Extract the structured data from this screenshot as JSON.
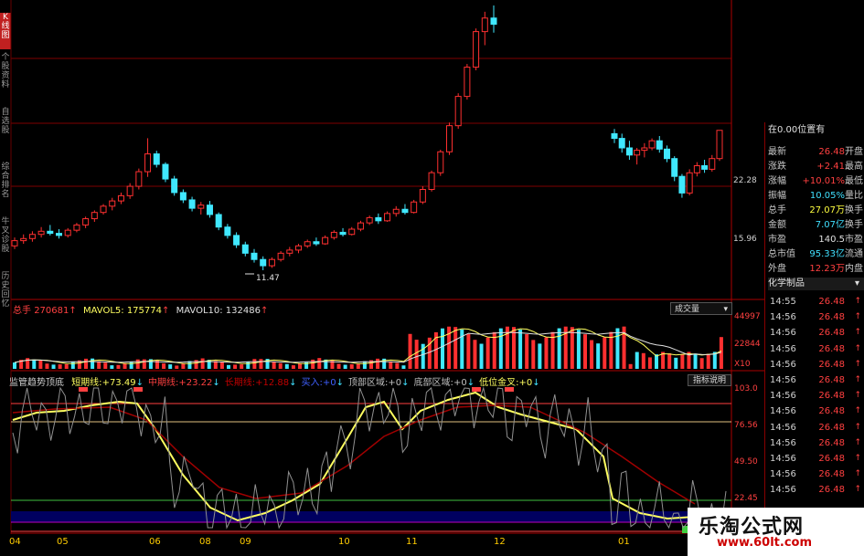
{
  "left_tabs": [
    {
      "label": "K线图",
      "active": true
    },
    {
      "label": "个股资料",
      "active": false
    },
    {
      "label": "自选股",
      "active": false
    },
    {
      "label": "综合排名",
      "active": false
    },
    {
      "label": "牛叉诊股",
      "active": false
    },
    {
      "label": "历史回忆",
      "active": false
    }
  ],
  "price_chart": {
    "price_labels": [
      "22.28",
      "15.96"
    ],
    "low_label": "11.47",
    "candles": [
      [
        13.8,
        14.6,
        13.5,
        14.3
      ],
      [
        14.3,
        14.9,
        14.0,
        14.5
      ],
      [
        14.5,
        15.2,
        14.2,
        14.9
      ],
      [
        14.9,
        15.6,
        14.6,
        15.2
      ],
      [
        15.2,
        15.8,
        14.8,
        15.0
      ],
      [
        15.0,
        15.4,
        14.5,
        14.8
      ],
      [
        14.8,
        15.5,
        14.6,
        15.3
      ],
      [
        15.3,
        16.0,
        15.1,
        15.8
      ],
      [
        15.8,
        16.6,
        15.5,
        16.4
      ],
      [
        16.4,
        17.2,
        16.1,
        17.0
      ],
      [
        17.0,
        17.8,
        16.8,
        17.6
      ],
      [
        17.6,
        18.4,
        17.2,
        18.1
      ],
      [
        18.1,
        18.9,
        17.8,
        18.6
      ],
      [
        18.6,
        19.8,
        18.3,
        19.5
      ],
      [
        19.5,
        21.2,
        19.2,
        20.9
      ],
      [
        20.9,
        24.1,
        20.4,
        22.6
      ],
      [
        22.6,
        22.9,
        21.3,
        21.6
      ],
      [
        21.6,
        21.8,
        19.9,
        20.2
      ],
      [
        20.2,
        20.5,
        18.6,
        18.9
      ],
      [
        18.9,
        19.2,
        17.9,
        18.2
      ],
      [
        18.2,
        18.5,
        17.1,
        17.4
      ],
      [
        17.4,
        18.0,
        16.8,
        17.7
      ],
      [
        17.7,
        18.1,
        16.5,
        16.8
      ],
      [
        16.8,
        17.0,
        15.3,
        15.6
      ],
      [
        15.6,
        15.9,
        14.5,
        14.8
      ],
      [
        14.8,
        15.1,
        13.6,
        13.9
      ],
      [
        13.9,
        14.2,
        12.8,
        13.1
      ],
      [
        13.1,
        13.5,
        12.2,
        12.5
      ],
      [
        12.5,
        12.8,
        11.47,
        11.9
      ],
      [
        11.9,
        12.7,
        11.7,
        12.5
      ],
      [
        12.5,
        13.3,
        12.3,
        13.1
      ],
      [
        13.1,
        13.7,
        12.8,
        13.4
      ],
      [
        13.4,
        14.0,
        13.1,
        13.8
      ],
      [
        13.8,
        14.4,
        13.6,
        14.2
      ],
      [
        14.2,
        14.6,
        13.8,
        14.0
      ],
      [
        14.0,
        14.8,
        13.9,
        14.6
      ],
      [
        14.6,
        15.3,
        14.4,
        15.1
      ],
      [
        15.1,
        15.5,
        14.7,
        14.9
      ],
      [
        14.9,
        15.6,
        14.8,
        15.4
      ],
      [
        15.4,
        16.2,
        15.2,
        16.0
      ],
      [
        16.0,
        16.7,
        15.8,
        16.5
      ],
      [
        16.5,
        16.9,
        15.9,
        16.2
      ],
      [
        16.2,
        17.1,
        16.1,
        16.9
      ],
      [
        16.9,
        17.6,
        16.6,
        17.3
      ],
      [
        17.3,
        17.8,
        16.8,
        17.0
      ],
      [
        17.0,
        18.2,
        16.9,
        18.0
      ],
      [
        18.0,
        19.5,
        17.8,
        19.2
      ],
      [
        19.2,
        21.0,
        19.0,
        20.8
      ],
      [
        20.8,
        23.0,
        20.5,
        22.8
      ],
      [
        22.8,
        25.6,
        22.5,
        25.3
      ],
      [
        25.3,
        28.4,
        25.0,
        28.1
      ],
      [
        28.1,
        31.2,
        27.8,
        30.9
      ],
      [
        30.9,
        34.6,
        30.6,
        34.3
      ],
      [
        34.3,
        36.2,
        33.0,
        35.6
      ],
      [
        35.6,
        36.8,
        34.2,
        35.0
      ]
    ],
    "candles_right": [
      [
        26.2,
        26.6,
        25.4,
        25.8
      ],
      [
        25.8,
        26.2,
        24.6,
        25.0
      ],
      [
        25.0,
        25.6,
        24.0,
        24.4
      ],
      [
        24.4,
        25.0,
        23.6,
        24.8
      ],
      [
        24.8,
        25.4,
        24.2,
        25.0
      ],
      [
        25.0,
        25.8,
        24.8,
        25.6
      ],
      [
        25.6,
        26.0,
        24.6,
        24.9
      ],
      [
        24.9,
        25.2,
        23.8,
        24.1
      ],
      [
        24.1,
        24.3,
        22.2,
        22.6
      ],
      [
        22.6,
        22.8,
        20.8,
        21.2
      ],
      [
        21.2,
        23.2,
        21.0,
        22.9
      ],
      [
        22.9,
        23.8,
        22.6,
        23.5
      ],
      [
        23.5,
        24.0,
        22.9,
        23.2
      ],
      [
        23.2,
        24.4,
        23.0,
        24.1
      ],
      [
        24.1,
        26.5,
        23.9,
        26.48
      ]
    ]
  },
  "volume": {
    "title": "总手",
    "value": "270681",
    "ma5_label": "MAVOL5:",
    "ma5_value": "175774",
    "ma10_label": "MAVOL10:",
    "ma10_value": "132486",
    "dropdown": "成交量",
    "axis_labels": [
      "44997",
      "22844",
      "X10"
    ]
  },
  "indicator": {
    "name": "监管趋势顶底",
    "items": [
      {
        "label": "短期线:",
        "value": "+73.49",
        "color": "#ffff60"
      },
      {
        "label": "中期线:",
        "value": "+23.22",
        "color": "#ff4040"
      },
      {
        "label": "长期线:",
        "value": "+12.88",
        "color": "#c00000"
      },
      {
        "label": "买入:",
        "value": "+0",
        "color": "#4060ff"
      },
      {
        "label": "顶部区域:",
        "value": "+0",
        "color": "#c0c0c0"
      },
      {
        "label": "底部区域:",
        "value": "+0",
        "color": "#c0c0c0"
      },
      {
        "label": "低位金叉:",
        "value": "+0",
        "color": "#ffff60"
      }
    ],
    "help_button": "指标说明",
    "axis_labels": [
      "103.0",
      "76.56",
      "49.50",
      "22.45"
    ]
  },
  "x_axis": [
    "04",
    "05",
    "06",
    "08",
    "09",
    "10",
    "11",
    "12",
    "01"
  ],
  "quote_panel": {
    "header": "在0.00位置有",
    "rows": [
      {
        "label": "最新",
        "value": "26.48",
        "color": "#ff4040",
        "right": "开盘"
      },
      {
        "label": "涨跌",
        "value": "+2.41",
        "color": "#ff4040",
        "right": "最高"
      },
      {
        "label": "涨幅",
        "value": "+10.01%",
        "color": "#ff4040",
        "right": "最低"
      },
      {
        "label": "振幅",
        "value": "10.05%",
        "color": "#40e0ff",
        "right": "量比"
      },
      {
        "label": "总手",
        "value": "27.07万",
        "color": "#ffff40",
        "right": "换手"
      },
      {
        "label": "金额",
        "value": "7.07亿",
        "color": "#40e0ff",
        "right": "换手"
      },
      {
        "label": "市盈",
        "value": "140.5",
        "color": "#e0e0e0",
        "right": "市盈"
      },
      {
        "label": "总市值",
        "value": "95.33亿",
        "color": "#40e0ff",
        "right": "流通"
      },
      {
        "label": "外盘",
        "value": "12.23万",
        "color": "#ff4040",
        "right": "内盘"
      }
    ],
    "industry": "化学制品",
    "ticks": [
      {
        "time": "14:55",
        "price": "26.48"
      },
      {
        "time": "14:56",
        "price": "26.48"
      },
      {
        "time": "14:56",
        "price": "26.48"
      },
      {
        "time": "14:56",
        "price": "26.48"
      },
      {
        "time": "14:56",
        "price": "26.48"
      },
      {
        "time": "14:56",
        "price": "26.48"
      },
      {
        "time": "14:56",
        "price": "26.48"
      },
      {
        "time": "14:56",
        "price": "26.48"
      },
      {
        "time": "14:56",
        "price": "26.48"
      },
      {
        "time": "14:56",
        "price": "26.48"
      },
      {
        "time": "14:56",
        "price": "26.48"
      },
      {
        "time": "14:56",
        "price": "26.48"
      },
      {
        "time": "14:56",
        "price": "26.48"
      }
    ]
  },
  "watermark": {
    "title": "乐淘公式网",
    "url": "www.60lt.com"
  },
  "colors": {
    "up": "#ff3030",
    "down": "#40e8ff",
    "grid": "#800000",
    "ma": "#e0e0e0"
  }
}
